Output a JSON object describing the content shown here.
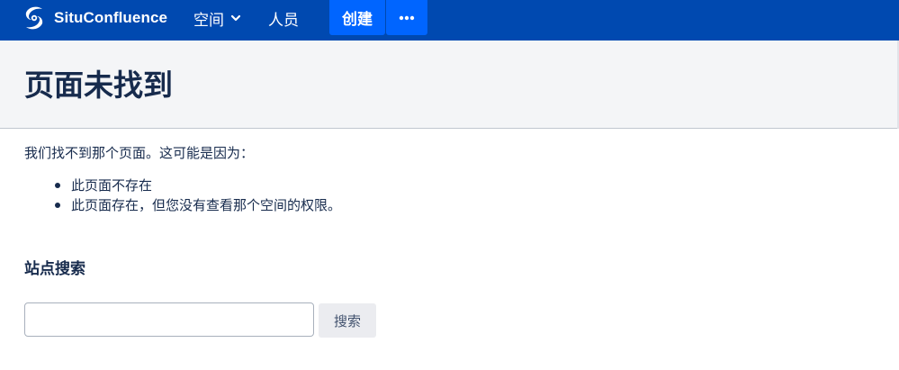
{
  "topnav": {
    "brand": {
      "name": "SituConfluence",
      "icon": "confluence-logo-icon"
    },
    "spaces_label": "空间",
    "people_label": "人员",
    "create_label": "创建",
    "more_icon": "more-horizontal-icon",
    "chevron_icon": "chevron-down-icon"
  },
  "page": {
    "title": "页面未找到",
    "intro": "我们找不到那个页面。这可能是因为：",
    "reasons": [
      "此页面不存在",
      "此页面存在，但您没有查看那个空间的权限。"
    ]
  },
  "search": {
    "heading": "站点搜索",
    "input_value": "",
    "button_label": "搜索"
  },
  "colors": {
    "nav_background": "#0049b0",
    "create_button": "#0065ff",
    "header_background": "#f4f5f7",
    "text": "#172b4d"
  }
}
